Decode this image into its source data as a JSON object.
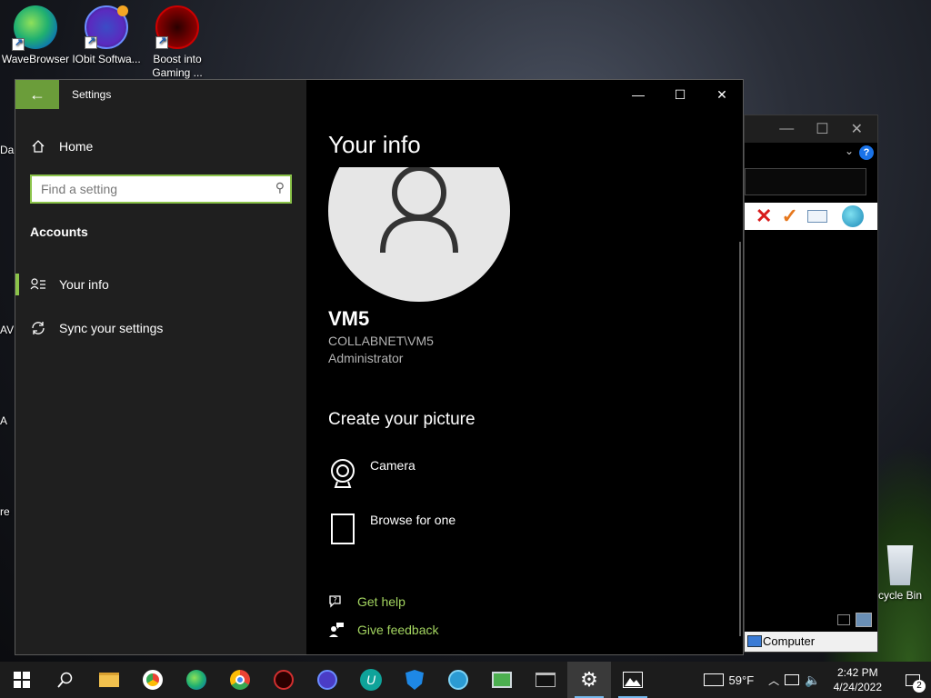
{
  "desktop": {
    "icons": [
      {
        "label": "WaveBrowser"
      },
      {
        "label": "IObit Softwa..."
      },
      {
        "label": "Boost into Gaming ..."
      }
    ],
    "edge_labels": [
      "Da",
      "AV",
      "A",
      "re"
    ],
    "recycle_label": "cycle Bin"
  },
  "background_window": {
    "help_label": "?",
    "status_text": "Computer"
  },
  "settings": {
    "app_title": "Settings",
    "sidebar": {
      "home_label": "Home",
      "search_placeholder": "Find a setting",
      "section_title": "Accounts",
      "items": [
        {
          "label": "Your info",
          "icon": "person-list-icon",
          "active": true
        },
        {
          "label": "Sync your settings",
          "icon": "sync-icon",
          "active": false
        }
      ]
    },
    "main": {
      "page_title": "Your info",
      "username": "VM5",
      "domain_account": "COLLABNET\\VM5",
      "role": "Administrator",
      "create_title": "Create your picture",
      "options": [
        {
          "label": "Camera",
          "icon": "webcam-icon"
        },
        {
          "label": "Browse for one",
          "icon": "blank-page-icon"
        }
      ],
      "links": [
        {
          "label": "Get help",
          "icon": "help-chat-icon"
        },
        {
          "label": "Give feedback",
          "icon": "feedback-person-icon"
        }
      ]
    }
  },
  "taskbar": {
    "weather": "59°F",
    "time": "2:42 PM",
    "date": "4/24/2022",
    "notification_count": "2",
    "accent": "#76b9ed"
  },
  "colors": {
    "settings_accent": "#8bc34a",
    "link_green": "#a2d35f"
  }
}
